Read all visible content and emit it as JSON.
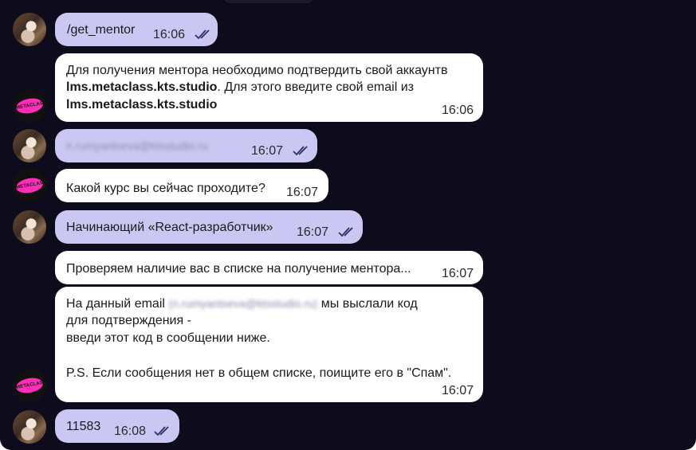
{
  "messages": [
    {
      "text": "/get_mentor",
      "time": "16:06"
    },
    {
      "line1": "Для получения ментора необходимо подтвердить свой аккаунтв",
      "bold1": "lms.metaclass.kts.studio",
      "line2_rest": ". Для этого введите свой email из",
      "bold2": "lms.metaclass.kts.studio",
      "time": "16:06"
    },
    {
      "text": "n.rumyantseva@ktsstudio.ru",
      "time": "16:07"
    },
    {
      "text": "Какой курс вы сейчас проходите?",
      "time": "16:07"
    },
    {
      "text": "Начинающий «React-разработчик»",
      "time": "16:07"
    },
    {
      "text": "Проверяем наличие вас в списке на получение ментора...",
      "time": "16:07"
    },
    {
      "line1_a": "На данный email",
      "email": "(n.rumyantseva@ktsstudio.ru)",
      "line1_b": "мы выслали код",
      "line2": "для подтверждения -",
      "line3": "введи этот код в сообщении ниже.",
      "line4": "P.S. Если сообщения нет в общем списке, поищите его в \"Спам\".",
      "time": "16:07"
    },
    {
      "text": "11583",
      "time": "16:08"
    }
  ],
  "avatars": {
    "bot_logo": "METACLASS"
  },
  "colors": {
    "background": "#0e0c1c",
    "outgoing": "#cbc7f3",
    "incoming": "#ffffff",
    "bot_logo": "#ff2db7"
  }
}
